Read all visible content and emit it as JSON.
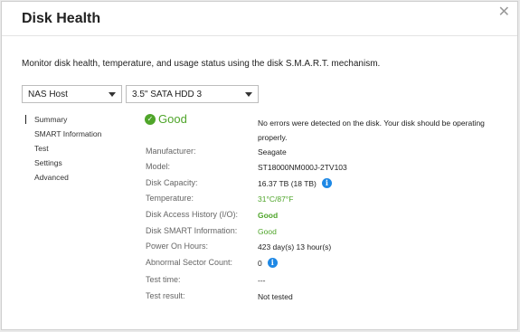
{
  "dialog": {
    "title": "Disk Health",
    "close_glyph": "✕",
    "description": "Monitor disk health, temperature, and usage status using the disk S.M.A.R.T. mechanism."
  },
  "selectors": {
    "host": "NAS Host",
    "disk": "3.5\" SATA HDD 3"
  },
  "nav": {
    "items": [
      "Summary",
      "SMART Information",
      "Test",
      "Settings",
      "Advanced"
    ],
    "active": "Summary"
  },
  "summary": {
    "status": "Good",
    "status_icon": "check-circle-icon",
    "message": "No errors were detected on the disk. Your disk should be operating properly.",
    "rows": [
      {
        "label": "Manufacturer:",
        "value": "Seagate"
      },
      {
        "label": "Model:",
        "value": "ST18000NM000J-2TV103"
      },
      {
        "label": "Disk Capacity:",
        "value": "16.37 TB (18 TB)"
      },
      {
        "label": "Temperature:",
        "value": "31°C/87°F"
      },
      {
        "label": "Disk Access History (I/O):",
        "value": "Good"
      },
      {
        "label": "Disk SMART Information:",
        "value": "Good"
      },
      {
        "label": "Power On Hours:",
        "value": "423 day(s) 13 hour(s)"
      },
      {
        "label": "Abnormal Sector Count:",
        "value": "0"
      },
      {
        "label": "Test time:",
        "value": "---"
      },
      {
        "label": "Test result:",
        "value": "Not tested"
      }
    ]
  },
  "colors": {
    "good": "#4fa52a",
    "info": "#1e88e5"
  }
}
